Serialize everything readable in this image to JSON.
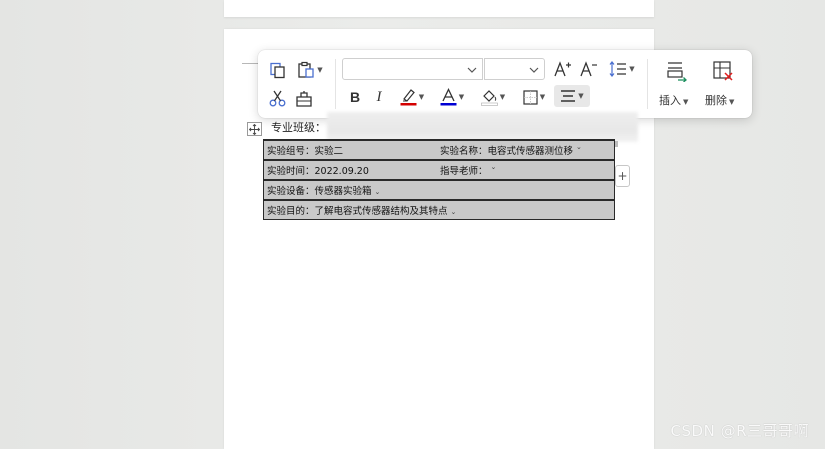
{
  "toolbar": {
    "font_name": "",
    "font_size": "",
    "insert_label": "插入",
    "delete_label": "删除",
    "buttons": [
      "copy-icon",
      "paste-icon",
      "cut-icon",
      "format-painter-icon",
      "bold-icon",
      "italic-icon",
      "highlight-icon",
      "font-color-icon",
      "fill-color-icon",
      "border-icon",
      "align-icon",
      "increase-font-icon",
      "decrease-font-icon",
      "line-spacing-icon",
      "insert-row-icon",
      "delete-table-icon"
    ],
    "highlight_color": "#d40000",
    "font_color": "#0000d4"
  },
  "document": {
    "pre_label": "专业班级：",
    "rows": [
      {
        "left": "实验组号：实验二",
        "right": "实验名称：电容式传感器测位移"
      },
      {
        "left": "实验时间：2022.09.20",
        "right": "指导老师："
      },
      {
        "left": "实验设备：传感器实验箱",
        "right": ""
      },
      {
        "left": "实验目的：了解电容式传感器结构及其特点",
        "right": ""
      }
    ]
  },
  "watermark": "CSDN @R三哥哥啊"
}
